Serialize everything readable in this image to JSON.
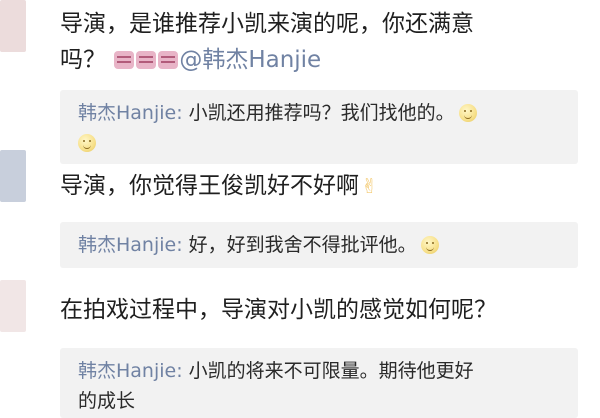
{
  "comments": [
    {
      "text": "导演，是谁推荐小凯来演的呢，你还满意",
      "line2": "吗？",
      "mention": "@韩杰Hanjie",
      "reply": {
        "user": "韩杰Hanjie:",
        "text": "小凯还用推荐吗？我们找他的。"
      }
    },
    {
      "text": "导演，你觉得王俊凯好不好啊",
      "reply": {
        "user": "韩杰Hanjie:",
        "text": "好，好到我舍不得批评他。"
      }
    },
    {
      "text": "在拍戏过程中，导演对小凯的感觉如何呢？",
      "reply": {
        "user": "韩杰Hanjie:",
        "text": "小凯的将来不可限量。期待他更好",
        "line2": "的成长"
      }
    }
  ],
  "icons": {
    "cry_emoji": "crying-face-icon",
    "smile_emoji": "smile-face-icon",
    "victory_emoji": "victory-hand-icon"
  }
}
